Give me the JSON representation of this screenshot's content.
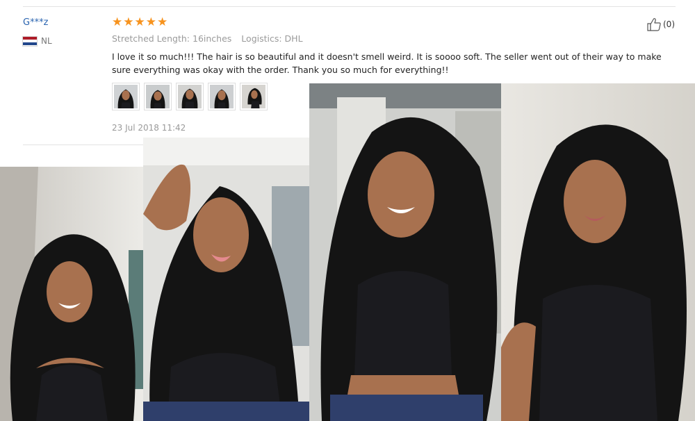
{
  "review": {
    "user_name": "G***z",
    "country_code": "NL",
    "country_flag_colors": [
      "#ae1c28",
      "#ffffff",
      "#21468b"
    ],
    "rating": 5,
    "star_glyph": "★",
    "star_color": "#f7931e",
    "attributes": {
      "length": "Stretched Length: 16inches",
      "logistics": "Logistics: DHL"
    },
    "text": "I love it so much!!! The hair is so beautiful and it doesn't smell weird. It is soooo soft. The seller went out of their way to make sure everything was okay with the order. Thank you so much for everything!!",
    "thumbnails": [
      "review-photo-1",
      "review-photo-2",
      "review-photo-3",
      "review-photo-4",
      "review-photo-5"
    ],
    "date": "23 Jul 2018 11:42",
    "helpful_icon": "thumbs-up-icon",
    "helpful_count": "(0)"
  },
  "photos": [
    "customer-photo-1",
    "customer-photo-2",
    "customer-photo-3",
    "customer-photo-4"
  ],
  "colors": {
    "username_link": "#2a64b0",
    "meta_text": "#9a9a9a",
    "body_text": "#222222",
    "divider": "#e3e3e3",
    "hair": "#141414",
    "skin": "#a8714f",
    "top": "#1b1b1f",
    "jeans": "#2f3f6b"
  }
}
